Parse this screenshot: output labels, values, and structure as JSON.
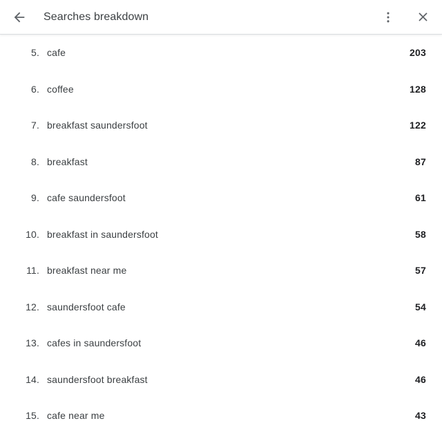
{
  "header": {
    "back_icon": "back-arrow-icon",
    "title": "Searches breakdown",
    "overflow_icon": "kebab-menu-icon",
    "close_icon": "close-icon"
  },
  "list": {
    "rows": [
      {
        "rank": "5.",
        "label": "cafe",
        "value": "203"
      },
      {
        "rank": "6.",
        "label": "coffee",
        "value": "128"
      },
      {
        "rank": "7.",
        "label": "breakfast saundersfoot",
        "value": "122"
      },
      {
        "rank": "8.",
        "label": "breakfast",
        "value": "87"
      },
      {
        "rank": "9.",
        "label": "cafe saundersfoot",
        "value": "61"
      },
      {
        "rank": "10.",
        "label": "breakfast in saundersfoot",
        "value": "58"
      },
      {
        "rank": "11.",
        "label": "breakfast near me",
        "value": "57"
      },
      {
        "rank": "12.",
        "label": "saundersfoot cafe",
        "value": "54"
      },
      {
        "rank": "13.",
        "label": "cafes in saundersfoot",
        "value": "46"
      },
      {
        "rank": "14.",
        "label": "saundersfoot breakfast",
        "value": "46"
      },
      {
        "rank": "15.",
        "label": "cafe near me",
        "value": "43"
      }
    ]
  },
  "colors": {
    "background": "#ffffff",
    "text_primary": "#3c4043",
    "text_value": "#202124",
    "divider": "#dadce0"
  }
}
